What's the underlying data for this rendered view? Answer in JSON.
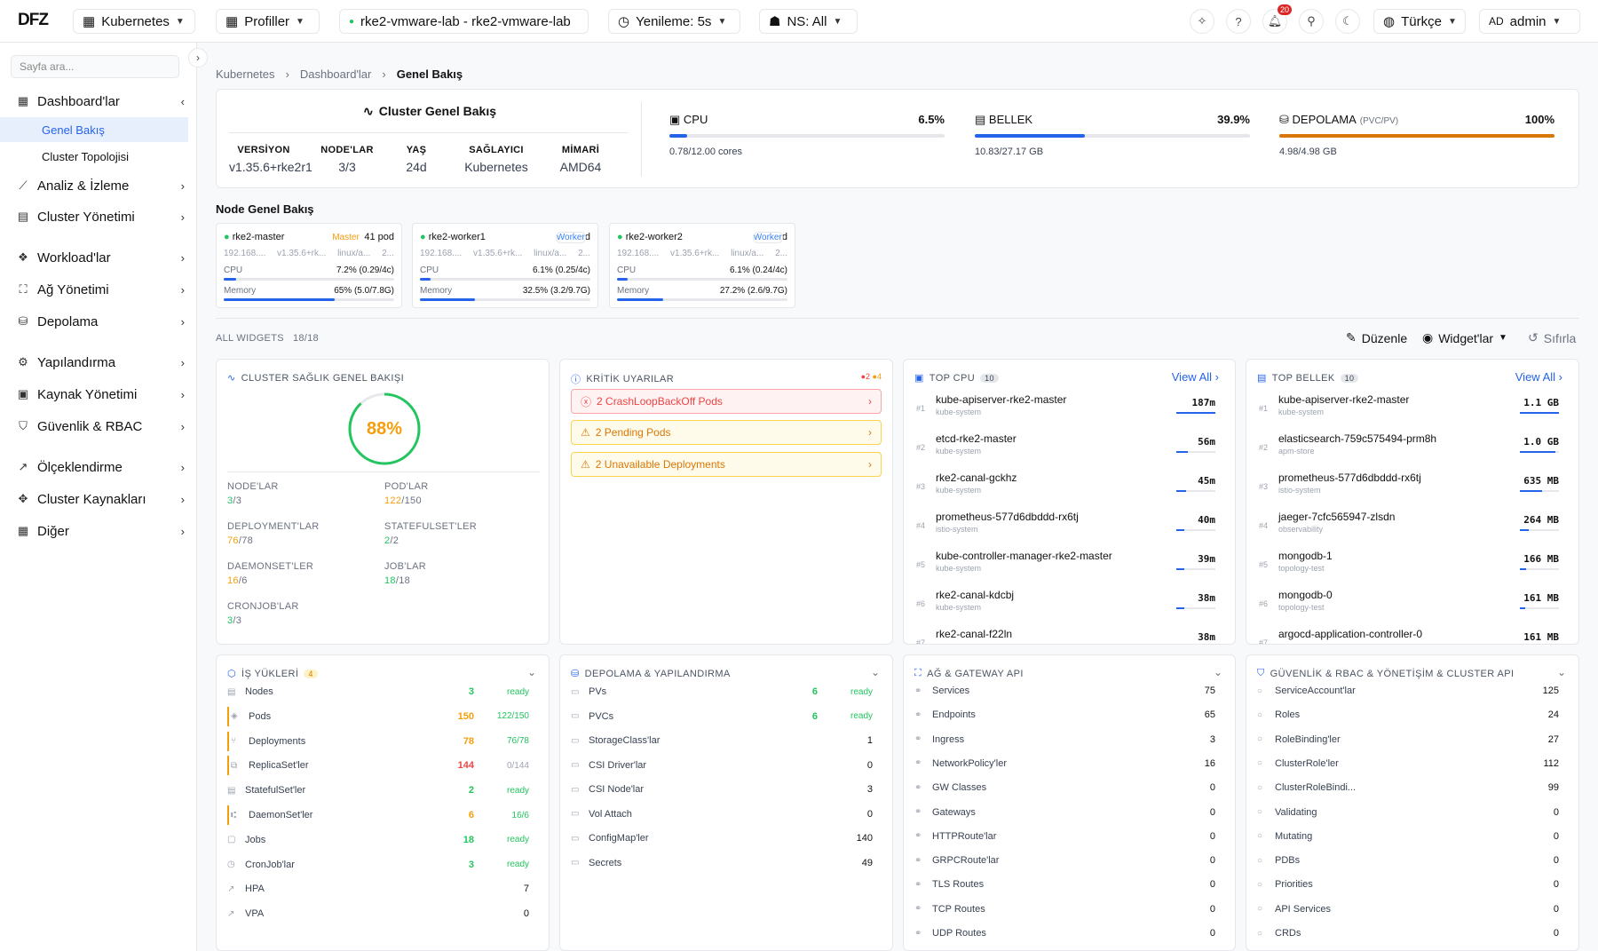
{
  "topbar": {
    "logo": "DFZ",
    "kubernetes": "Kubernetes",
    "profiles": "Profiller",
    "cluster": "rke2-vmware-lab - rke2-vmware-lab",
    "refresh": "Yenileme: 5s",
    "ns": "NS: All",
    "notifications": "20",
    "language": "Türkçe",
    "user_initials": "AD",
    "user": "admin"
  },
  "sidebar": {
    "search_placeholder": "Sayfa ara...",
    "items": [
      {
        "label": "Dashboard'lar",
        "icon": "grid-icon"
      },
      {
        "label": "Analiz & İzleme",
        "icon": "chart-line-icon"
      },
      {
        "label": "Cluster Yönetimi",
        "icon": "server-icon"
      },
      {
        "label": "Workload'lar",
        "icon": "cubes-icon"
      },
      {
        "label": "Ağ Yönetimi",
        "icon": "network-icon"
      },
      {
        "label": "Depolama",
        "icon": "database-icon"
      },
      {
        "label": "Yapılandırma",
        "icon": "gear-icon"
      },
      {
        "label": "Kaynak Yönetimi",
        "icon": "resource-icon"
      },
      {
        "label": "Güvenlik & RBAC",
        "icon": "shield-icon"
      },
      {
        "label": "Ölçeklendirme",
        "icon": "trend-icon"
      },
      {
        "label": "Cluster Kaynakları",
        "icon": "diamond-icon"
      },
      {
        "label": "Diğer",
        "icon": "grid-icon"
      }
    ],
    "subitems": [
      "Genel Bakış",
      "Cluster Topolojisi"
    ]
  },
  "breadcrumb": [
    "Kubernetes",
    "Dashboard'lar",
    "Genel Bakış"
  ],
  "overview": {
    "title": "Cluster Genel Bakış",
    "info": [
      {
        "k": "VERSİYON",
        "v": "v1.35.6+rke2r1"
      },
      {
        "k": "NODE'LAR",
        "v": "3/3"
      },
      {
        "k": "YAŞ",
        "v": "24d"
      },
      {
        "k": "SAĞLAYICI",
        "v": "Kubernetes"
      },
      {
        "k": "MİMARİ",
        "v": "AMD64"
      }
    ],
    "cpu": {
      "label": "CPU",
      "pct": "6.5%",
      "sub": "0.78/12.00 cores",
      "fill": 6.5
    },
    "mem": {
      "label": "BELLEK",
      "pct": "39.9%",
      "sub": "10.83/27.17 GB",
      "fill": 39.9
    },
    "storage": {
      "label": "DEPOLAMA",
      "extra": "(PVC/PV)",
      "pct": "100%",
      "sub": "4.98/4.98 GB",
      "fill": 100
    }
  },
  "nodes_title": "Node Genel Bakış",
  "nodes": [
    {
      "name": "rke2-master",
      "role": "Master",
      "pods": "41 pod",
      "ip": "192.168....",
      "ver": "v1.35.6+rk...",
      "os": "linux/a...",
      "extra": "2...",
      "cpu_label": "CPU",
      "cpu": "7.2% (0.29/4c)",
      "mem_label": "Memory",
      "mem": "65% (5.0/7.8G)",
      "cpu_fill": 7.2,
      "mem_fill": 65
    },
    {
      "name": "rke2-worker1",
      "role": "Worker",
      "pods": "46 pod",
      "ip": "192.168....",
      "ver": "v1.35.6+rk...",
      "os": "linux/a...",
      "extra": "2...",
      "cpu_label": "CPU",
      "cpu": "6.1% (0.25/4c)",
      "mem_label": "Memory",
      "mem": "32.5% (3.2/9.7G)",
      "cpu_fill": 6.1,
      "mem_fill": 32.5
    },
    {
      "name": "rke2-worker2",
      "role": "Worker",
      "pods": "61 pod",
      "ip": "192.168....",
      "ver": "v1.35.6+rk...",
      "os": "linux/a...",
      "extra": "2...",
      "cpu_label": "CPU",
      "cpu": "6.1% (0.24/4c)",
      "mem_label": "Memory",
      "mem": "27.2% (2.6/9.7G)",
      "cpu_fill": 6.1,
      "mem_fill": 27.2
    }
  ],
  "widgets": {
    "label": "ALL WIDGETS",
    "count": "18/18",
    "edit": "Düzenle",
    "widgets_btn": "Widget'lar",
    "reset": "Sıfırla"
  },
  "health": {
    "title": "CLUSTER SAĞLIK GENEL BAKIŞI",
    "score": "88%",
    "score_value": 88,
    "stats": [
      {
        "k": "NODE'LAR",
        "a": "3",
        "b": "/3",
        "c": "g"
      },
      {
        "k": "POD'LAR",
        "a": "122",
        "b": "/150",
        "c": "o"
      },
      {
        "k": "DEPLOYMENT'LAR",
        "a": "76",
        "b": "/78",
        "c": "o"
      },
      {
        "k": "STATEFULSET'LER",
        "a": "2",
        "b": "/2",
        "c": "g"
      },
      {
        "k": "DAEMONSET'LER",
        "a": "16",
        "b": "/6",
        "c": "o"
      },
      {
        "k": "JOB'LAR",
        "a": "18",
        "b": "/18",
        "c": "g"
      },
      {
        "k": "CRONJOB'LAR",
        "a": "3",
        "b": "/3",
        "c": "g"
      }
    ]
  },
  "alerts": {
    "title": "KRİTİK UYARILAR",
    "red": "2",
    "amber": "4",
    "items": [
      {
        "text": "2 CrashLoopBackOff Pods",
        "type": "red"
      },
      {
        "text": "2 Pending Pods",
        "type": "amb"
      },
      {
        "text": "2 Unavailable Deployments",
        "type": "amb"
      }
    ]
  },
  "top_cpu": {
    "title": "TOP CPU",
    "count": "10",
    "view_all": "View All",
    "items": [
      {
        "rank": "#1",
        "name": "kube-apiserver-rke2-master",
        "ns": "kube-system",
        "val": "187m",
        "fill": 100
      },
      {
        "rank": "#2",
        "name": "etcd-rke2-master",
        "ns": "kube-system",
        "val": "56m",
        "fill": 30
      },
      {
        "rank": "#3",
        "name": "rke2-canal-gckhz",
        "ns": "kube-system",
        "val": "45m",
        "fill": 24
      },
      {
        "rank": "#4",
        "name": "prometheus-577d6dbddd-rx6tj",
        "ns": "istio-system",
        "val": "40m",
        "fill": 21
      },
      {
        "rank": "#5",
        "name": "kube-controller-manager-rke2-master",
        "ns": "kube-system",
        "val": "39m",
        "fill": 21
      },
      {
        "rank": "#6",
        "name": "rke2-canal-kdcbj",
        "ns": "kube-system",
        "val": "38m",
        "fill": 20
      },
      {
        "rank": "#7",
        "name": "rke2-canal-f22ln",
        "ns": "",
        "val": "38m",
        "fill": 20
      }
    ]
  },
  "top_mem": {
    "title": "TOP BELLEK",
    "count": "10",
    "view_all": "View All",
    "items": [
      {
        "rank": "#1",
        "name": "kube-apiserver-rke2-master",
        "ns": "kube-system",
        "val": "1.1 GB",
        "fill": 100
      },
      {
        "rank": "#2",
        "name": "elasticsearch-759c575494-prm8h",
        "ns": "apm-store",
        "val": "1.0 GB",
        "fill": 90
      },
      {
        "rank": "#3",
        "name": "prometheus-577d6dbddd-rx6tj",
        "ns": "istio-system",
        "val": "635 MB",
        "fill": 56
      },
      {
        "rank": "#4",
        "name": "jaeger-7cfc565947-zlsdn",
        "ns": "observability",
        "val": "264 MB",
        "fill": 23
      },
      {
        "rank": "#5",
        "name": "mongodb-1",
        "ns": "topology-test",
        "val": "166 MB",
        "fill": 15
      },
      {
        "rank": "#6",
        "name": "mongodb-0",
        "ns": "topology-test",
        "val": "161 MB",
        "fill": 14
      },
      {
        "rank": "#7",
        "name": "argocd-application-controller-0",
        "ns": "",
        "val": "161 MB",
        "fill": 14
      }
    ]
  },
  "workloads": {
    "title": "İŞ YÜKLERİ",
    "count": "4",
    "items": [
      {
        "n": "Nodes",
        "v": "3",
        "s": "ready",
        "vc": "g",
        "sc": "g",
        "hl": false
      },
      {
        "n": "Pods",
        "v": "150",
        "s": "122/150",
        "vc": "o",
        "sc": "g",
        "hl": true
      },
      {
        "n": "Deployments",
        "v": "78",
        "s": "76/78",
        "vc": "o",
        "sc": "g",
        "hl": true
      },
      {
        "n": "ReplicaSet'ler",
        "v": "144",
        "s": "0/144",
        "vc": "rd",
        "sc": "gy",
        "hl": true
      },
      {
        "n": "StatefulSet'ler",
        "v": "2",
        "s": "ready",
        "vc": "g",
        "sc": "g",
        "hl": false
      },
      {
        "n": "DaemonSet'ler",
        "v": "6",
        "s": "16/6",
        "vc": "o",
        "sc": "g",
        "hl": true
      },
      {
        "n": "Jobs",
        "v": "18",
        "s": "ready",
        "vc": "g",
        "sc": "g",
        "hl": false
      },
      {
        "n": "CronJob'lar",
        "v": "3",
        "s": "ready",
        "vc": "g",
        "sc": "g",
        "hl": false
      },
      {
        "n": "HPA",
        "v": "",
        "s": "7",
        "vc": "",
        "sc": "",
        "hl": false
      },
      {
        "n": "VPA",
        "v": "",
        "s": "0",
        "vc": "",
        "sc": "",
        "hl": false
      }
    ]
  },
  "storage_cfg": {
    "title": "DEPOLAMA & YAPILANDIRMA",
    "items": [
      {
        "n": "PVs",
        "v": "6",
        "s": "ready"
      },
      {
        "n": "PVCs",
        "v": "6",
        "s": "ready"
      },
      {
        "n": "StorageClass'lar",
        "v": "",
        "s": "1"
      },
      {
        "n": "CSI Driver'lar",
        "v": "",
        "s": "0"
      },
      {
        "n": "CSI Node'lar",
        "v": "",
        "s": "3"
      },
      {
        "n": "Vol Attach",
        "v": "",
        "s": "0"
      },
      {
        "n": "ConfigMap'ler",
        "v": "",
        "s": "140"
      },
      {
        "n": "Secrets",
        "v": "",
        "s": "49"
      }
    ]
  },
  "network": {
    "title": "AĞ & GATEWAY API",
    "items": [
      {
        "n": "Services",
        "s": "75"
      },
      {
        "n": "Endpoints",
        "s": "65"
      },
      {
        "n": "Ingress",
        "s": "3"
      },
      {
        "n": "NetworkPolicy'ler",
        "s": "16"
      },
      {
        "n": "GW Classes",
        "s": "0"
      },
      {
        "n": "Gateways",
        "s": "0"
      },
      {
        "n": "HTTPRoute'lar",
        "s": "0"
      },
      {
        "n": "GRPCRoute'lar",
        "s": "0"
      },
      {
        "n": "TLS Routes",
        "s": "0"
      },
      {
        "n": "TCP Routes",
        "s": "0"
      },
      {
        "n": "UDP Routes",
        "s": "0"
      }
    ]
  },
  "security": {
    "title": "GÜVENLİK & RBAC & YÖNETİŞİM & CLUSTER API",
    "items": [
      {
        "n": "ServiceAccount'lar",
        "s": "125"
      },
      {
        "n": "Roles",
        "s": "24"
      },
      {
        "n": "RoleBinding'ler",
        "s": "27"
      },
      {
        "n": "ClusterRole'ler",
        "s": "112"
      },
      {
        "n": "ClusterRoleBindi...",
        "s": "99"
      },
      {
        "n": "Validating",
        "s": "0"
      },
      {
        "n": "Mutating",
        "s": "0"
      },
      {
        "n": "PDBs",
        "s": "0"
      },
      {
        "n": "Priorities",
        "s": "0"
      },
      {
        "n": "API Services",
        "s": "0"
      },
      {
        "n": "CRDs",
        "s": "0"
      }
    ]
  },
  "colors": {
    "accent": "#2563eb",
    "ok": "#22c55e",
    "warn": "#f59e0b",
    "danger": "#ef4444",
    "storage": "#d97706"
  }
}
